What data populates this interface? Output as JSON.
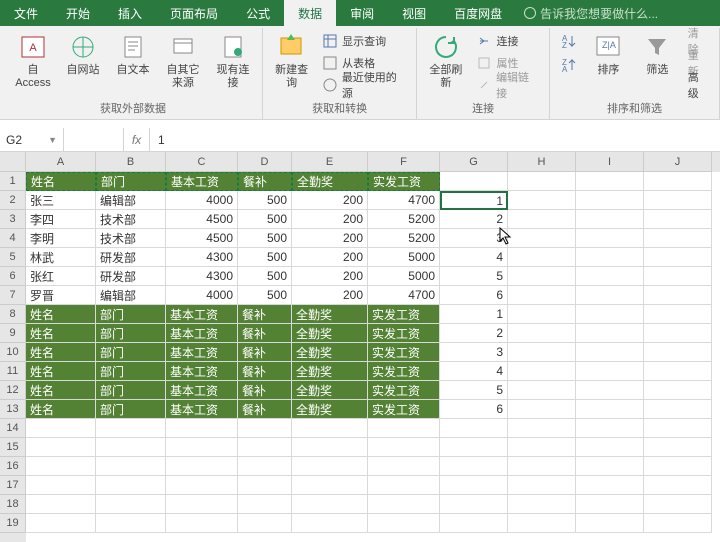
{
  "tabs": [
    "文件",
    "开始",
    "插入",
    "页面布局",
    "公式",
    "数据",
    "审阅",
    "视图",
    "百度网盘"
  ],
  "active_tab": 5,
  "tell_me": "告诉我您想要做什么...",
  "ribbon": {
    "g1": {
      "label": "获取外部数据",
      "btns": [
        "自 Access",
        "自网站",
        "自文本",
        "自其它来源",
        "现有连接"
      ]
    },
    "g2": {
      "label": "获取和转换",
      "new_query": "新建查询",
      "items": [
        "显示查询",
        "从表格",
        "最近使用的源"
      ]
    },
    "g3": {
      "label": "连接",
      "refresh": "全部刷新",
      "items": [
        "连接",
        "属性",
        "编辑链接"
      ]
    },
    "g4": {
      "label": "排序和筛选",
      "sort": "排序",
      "filter": "筛选",
      "adv": [
        "清除",
        "重新",
        "高级"
      ]
    }
  },
  "name_box": "G2",
  "formula": "1",
  "cols": [
    "A",
    "B",
    "C",
    "D",
    "E",
    "F",
    "G",
    "H",
    "I",
    "J"
  ],
  "headers": [
    "姓名",
    "部门",
    "基本工资",
    "餐补",
    "全勤奖",
    "实发工资"
  ],
  "data_rows": [
    {
      "n": "张三",
      "d": "编辑部",
      "b": 4000,
      "c": 500,
      "q": 200,
      "s": 4700,
      "g": 1
    },
    {
      "n": "李四",
      "d": "技术部",
      "b": 4500,
      "c": 500,
      "q": 200,
      "s": 5200,
      "g": 2
    },
    {
      "n": "李明",
      "d": "技术部",
      "b": 4500,
      "c": 500,
      "q": 200,
      "s": 5200,
      "g": 3
    },
    {
      "n": "林武",
      "d": "研发部",
      "b": 4300,
      "c": 500,
      "q": 200,
      "s": 5000,
      "g": 4
    },
    {
      "n": "张红",
      "d": "研发部",
      "b": 4300,
      "c": 500,
      "q": 200,
      "s": 5000,
      "g": 5
    },
    {
      "n": "罗晋",
      "d": "编辑部",
      "b": 4000,
      "c": 500,
      "q": 200,
      "s": 4700,
      "g": 6
    }
  ],
  "green_rows": [
    1,
    2,
    3,
    4,
    5,
    6
  ],
  "chart_data": {
    "type": "table",
    "title": "",
    "columns": [
      "姓名",
      "部门",
      "基本工资",
      "餐补",
      "全勤奖",
      "实发工资"
    ],
    "rows": [
      [
        "张三",
        "编辑部",
        4000,
        500,
        200,
        4700
      ],
      [
        "李四",
        "技术部",
        4500,
        500,
        200,
        5200
      ],
      [
        "李明",
        "技术部",
        4500,
        500,
        200,
        5200
      ],
      [
        "林武",
        "研发部",
        4300,
        500,
        200,
        5000
      ],
      [
        "张红",
        "研发部",
        4300,
        500,
        200,
        5000
      ],
      [
        "罗晋",
        "编辑部",
        4000,
        500,
        200,
        4700
      ]
    ]
  }
}
